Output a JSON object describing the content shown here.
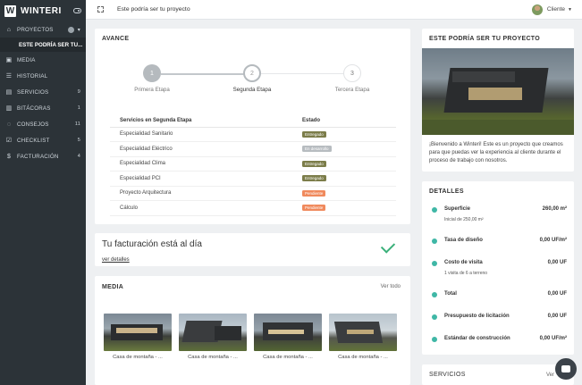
{
  "brand": {
    "name": "WINTERI",
    "logo_letter": "W"
  },
  "sidebar": {
    "items": [
      {
        "label": "PROYECTOS",
        "icon": "home-icon",
        "badge": ""
      },
      {
        "label": "MEDIA",
        "icon": "image-icon",
        "badge": ""
      },
      {
        "label": "HISTORIAL",
        "icon": "list-icon",
        "badge": ""
      },
      {
        "label": "SERVICIOS",
        "icon": "document-icon",
        "badge": "9"
      },
      {
        "label": "BITÁCORAS",
        "icon": "book-icon",
        "badge": "1"
      },
      {
        "label": "CONSEJOS",
        "icon": "chat-icon",
        "badge": "11"
      },
      {
        "label": "CHECKLIST",
        "icon": "checkbox-icon",
        "badge": "5"
      },
      {
        "label": "FACTURACIÓN",
        "icon": "dollar-icon",
        "badge": "4"
      }
    ],
    "sub_item": "ESTE PODRÍA SER TU..."
  },
  "topbar": {
    "title": "Este podría ser tu proyecto",
    "user": "Cliente"
  },
  "avance": {
    "title": "AVANCE",
    "steps": [
      {
        "number": "1",
        "label": "Primera Etapa",
        "state": "done"
      },
      {
        "number": "2",
        "label": "Segunda Etapa",
        "state": "current"
      },
      {
        "number": "3",
        "label": "Tercera Etapa",
        "state": "pending"
      }
    ],
    "table": {
      "headers": [
        "Servicios en Segunda Etapa",
        "Estado"
      ],
      "rows": [
        {
          "service": "Especialidad Sanitario",
          "status": "Entregado",
          "color": "#7c7d4a"
        },
        {
          "service": "Especialidad Eléctrico",
          "status": "En desarrollo",
          "color": "#b7bcc0"
        },
        {
          "service": "Especialidad Clima",
          "status": "Entregado",
          "color": "#7c7d4a"
        },
        {
          "service": "Especialidad PCI",
          "status": "Entregado",
          "color": "#7c7d4a"
        },
        {
          "service": "Proyecto Arquitectura",
          "status": "Pendiente",
          "color": "#f08a5d"
        },
        {
          "service": "Cálculo",
          "status": "Pendiente",
          "color": "#f08a5d"
        }
      ]
    }
  },
  "facturacion": {
    "title": "Tu facturación está al día",
    "link": "ver detalles"
  },
  "media": {
    "title": "MEDIA",
    "link": "Ver todo",
    "items": [
      {
        "caption": "Casa de montaña - ..."
      },
      {
        "caption": "Casa de montaña - ..."
      },
      {
        "caption": "Casa de montaña - ..."
      },
      {
        "caption": "Casa de montaña - ..."
      }
    ]
  },
  "proyecto": {
    "title": "ESTE PODRÍA SER TU PROYECTO",
    "description": "¡Bienvenido a Winteri! Este es un proyecto que creamos para que puedas ver la experiencia al cliente durante el proceso de trabajo con nosotros."
  },
  "detalles": {
    "title": "DETALLES",
    "rows": [
      {
        "label": "Superficie",
        "sub": "Inicial de 250,00 m²",
        "value": "260,00 m²",
        "icon": "resize-icon"
      },
      {
        "label": "Tasa de diseño",
        "sub": "",
        "value": "0,00 UF/m²",
        "icon": "rate-icon"
      },
      {
        "label": "Costo de visita",
        "sub": "1 visita de 6 a terreno",
        "value": "0,00 UF",
        "icon": "visit-icon"
      },
      {
        "label": "Total",
        "sub": "",
        "value": "0,00 UF",
        "icon": "total-icon"
      },
      {
        "label": "Presupuesto de licitación",
        "sub": "",
        "value": "0,00 UF",
        "icon": "budget-icon"
      },
      {
        "label": "Estándar de construcción",
        "sub": "",
        "value": "0,00 UF/m²",
        "icon": "standard-icon"
      }
    ]
  },
  "servicios": {
    "title": "SERVICIOS",
    "link": "Ver"
  },
  "colors": {
    "sidebar": "#2c3338",
    "accent": "#3fb7a6",
    "check": "#3ab07a"
  }
}
